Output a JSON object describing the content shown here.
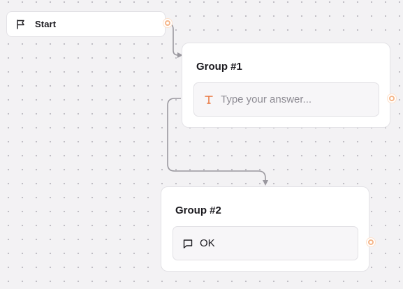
{
  "canvas": {
    "start_node": {
      "label": "Start",
      "icon": "flag-icon"
    },
    "groups": [
      {
        "title": "Group #1",
        "block": {
          "type": "text-input",
          "icon": "text-input-icon",
          "placeholder": "Type your answer...",
          "icon_color": "#e8743b"
        }
      },
      {
        "title": "Group #2",
        "block": {
          "type": "text-bubble",
          "icon": "chat-bubble-icon",
          "value": "OK"
        }
      }
    ],
    "colors": {
      "edge": "#9a989f",
      "port_ring": "#f6b68a",
      "accent": "#e8743b"
    }
  }
}
